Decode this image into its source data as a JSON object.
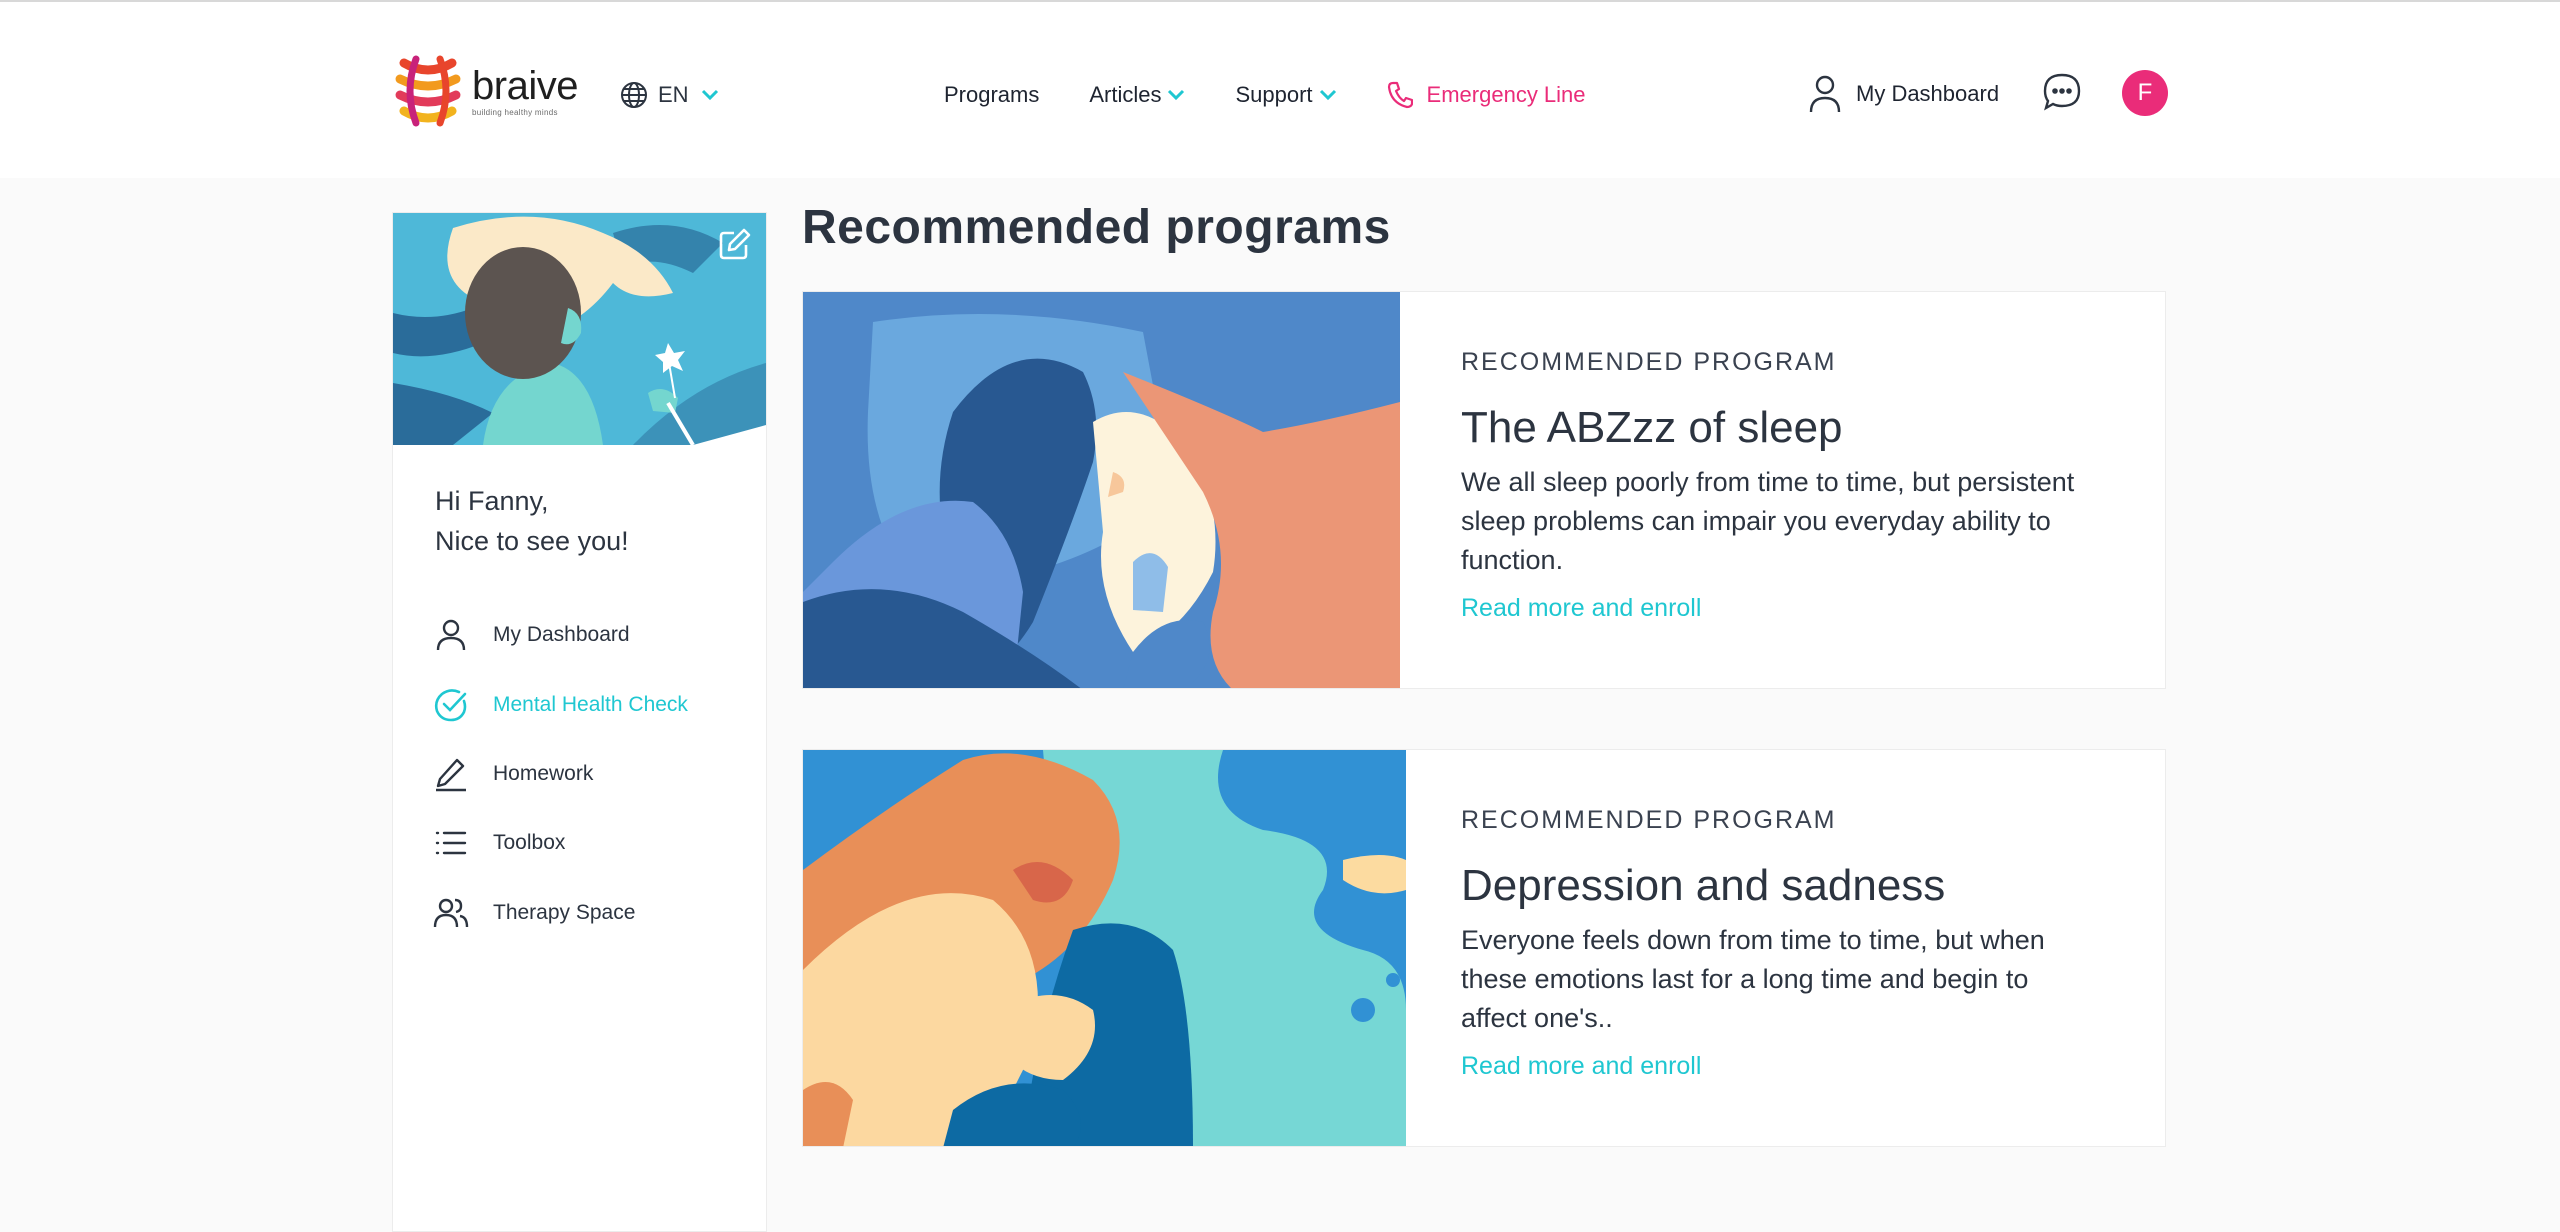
{
  "header": {
    "brand_name": "braive",
    "brand_tagline": "building healthy minds",
    "language": "EN",
    "nav": {
      "programs": "Programs",
      "articles": "Articles",
      "support": "Support",
      "emergency": "Emergency Line"
    },
    "dashboard_label": "My Dashboard",
    "avatar_initial": "F"
  },
  "sidebar": {
    "greeting_line1": "Hi Fanny,",
    "greeting_line2": "Nice to see you!",
    "items": [
      {
        "label": "My Dashboard",
        "icon": "user-icon"
      },
      {
        "label": "Mental Health Check",
        "icon": "check-circle-icon",
        "active": true
      },
      {
        "label": "Homework",
        "icon": "pencil-icon"
      },
      {
        "label": "Toolbox",
        "icon": "list-icon"
      },
      {
        "label": "Therapy Space",
        "icon": "users-icon"
      }
    ]
  },
  "main": {
    "title": "Recommended programs",
    "cards": [
      {
        "eyebrow": "RECOMMENDED PROGRAM",
        "title": "The ABZzz of sleep",
        "description": "We all sleep poorly from time to time, but persistent sleep problems can impair you everyday ability to function.",
        "link": "Read more and enroll"
      },
      {
        "eyebrow": "RECOMMENDED PROGRAM",
        "title": "Depression and sadness",
        "description": "Everyone feels down from time to time, but when these emotions last for a long time and begin to affect one's..",
        "link": "Read more and enroll"
      }
    ]
  },
  "colors": {
    "accent": "#1fc7d1",
    "emergency": "#ea2c79",
    "text": "#2c3440",
    "background": "#fafafa"
  }
}
